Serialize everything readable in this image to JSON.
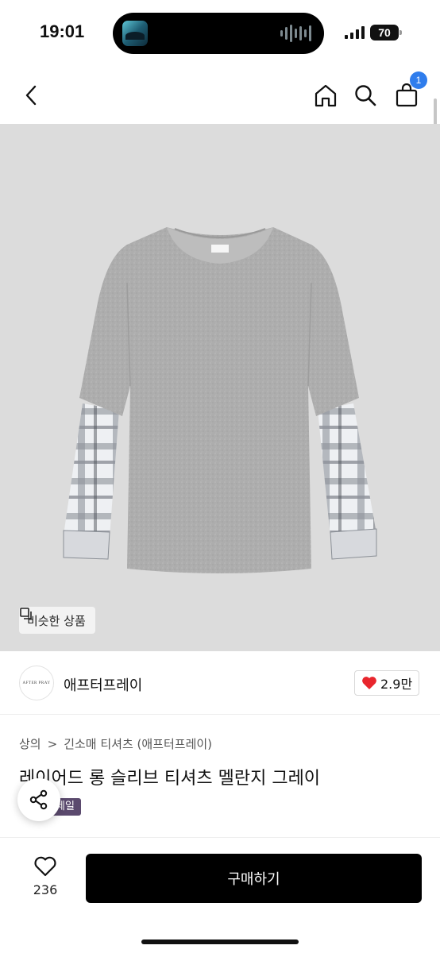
{
  "status_bar": {
    "time": "19:01",
    "battery": "70"
  },
  "nav": {
    "cart_badge": "1"
  },
  "similar_button": {
    "label": "비슷한 상품"
  },
  "brand": {
    "name": "애프터프레이",
    "logo_text": "AFTER PRAY",
    "likes": "2.9만"
  },
  "breadcrumb": {
    "category": "상의",
    "separator": ">",
    "subcategory": "긴소매 티셔츠 (애프터프레이)"
  },
  "product": {
    "title": "레이어드 롱 슬리브 티셔츠 멜란지 그레이",
    "badge": "세일"
  },
  "bottom_bar": {
    "wish_count": "236",
    "buy_label": "구매하기"
  },
  "colors": {
    "accent_badge": "#2f7dec",
    "heart": "#e8262d",
    "buy_button": "#000000",
    "sale_badge": "#5b4a6e"
  },
  "icons": [
    "back-icon",
    "home-icon",
    "search-icon",
    "cart-icon",
    "copy-icon",
    "heart-icon",
    "share-icon"
  ]
}
